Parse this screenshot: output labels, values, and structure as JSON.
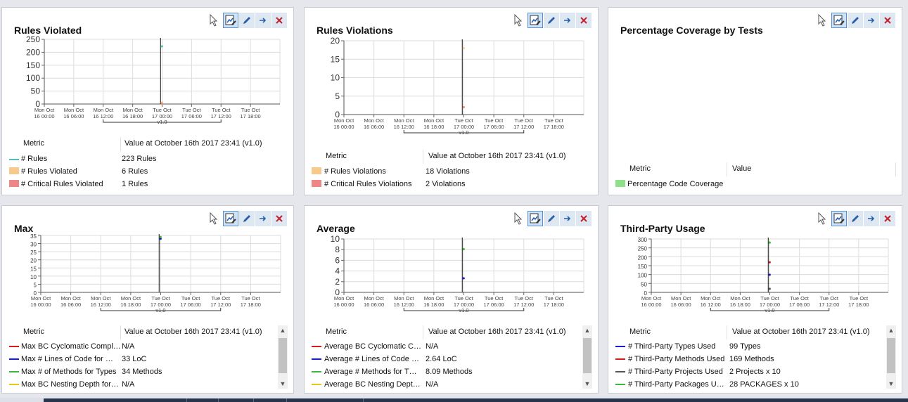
{
  "panels": [
    {
      "title": "Rules Violated",
      "legend_header": {
        "metric": "Metric",
        "value": "Value at October 16th 2017  23:41  (v1.0)"
      },
      "rows": [
        {
          "label": "# Rules",
          "value": "223 Rules",
          "color": "#4fc1b3"
        },
        {
          "label": "# Rules Violated",
          "value": "6 Rules",
          "color": "#f7c98d"
        },
        {
          "label": "# Critical Rules Violated",
          "value": "1 Rules",
          "color": "#f08585"
        }
      ],
      "chart": {
        "y_ticks": [
          "250",
          "200",
          "150",
          "100",
          "50",
          "0"
        ],
        "x_ticks": [
          [
            "Mon Oct",
            "16 00:00"
          ],
          [
            "Mon Oct",
            "16 06:00"
          ],
          [
            "Mon Oct",
            "16 12:00"
          ],
          [
            "Mon Oct",
            "16 18:00"
          ],
          [
            "Tue Oct",
            "17 00:00"
          ],
          [
            "Tue Oct",
            "17 06:00"
          ],
          [
            "Tue Oct",
            "17 12:00"
          ],
          [
            "Tue Oct",
            "17 18:00"
          ]
        ],
        "version": "v1.0"
      }
    },
    {
      "title": "Rules Violations",
      "legend_header": {
        "metric": "Metric",
        "value": "Value at October 16th 2017  23:41  (v1.0)"
      },
      "rows": [
        {
          "label": "# Rules Violations",
          "value": "18 Violations",
          "color": "#f7c98d"
        },
        {
          "label": "# Critical Rules Violations",
          "value": "2 Violations",
          "color": "#f08585"
        }
      ],
      "chart": {
        "y_ticks": [
          "20",
          "15",
          "10",
          "5",
          "0"
        ],
        "x_ticks": [
          [
            "Mon Oct",
            "16 00:00"
          ],
          [
            "Mon Oct",
            "16 06:00"
          ],
          [
            "Mon Oct",
            "16 12:00"
          ],
          [
            "Mon Oct",
            "16 18:00"
          ],
          [
            "Tue Oct",
            "17 00:00"
          ],
          [
            "Tue Oct",
            "17 06:00"
          ],
          [
            "Tue Oct",
            "17 12:00"
          ],
          [
            "Tue Oct",
            "17 18:00"
          ]
        ],
        "version": "v1.0"
      }
    },
    {
      "title": "Percentage Coverage by Tests",
      "legend_header": {
        "metric": "Metric",
        "value": "Value"
      },
      "rows": [
        {
          "label": "Percentage Code Coverage",
          "value": "",
          "color": "#8fe08a"
        }
      ]
    },
    {
      "title": "Max",
      "legend_header": {
        "metric": "Metric",
        "value": "Value at October 16th 2017  23:41  (v1.0)"
      },
      "rows": [
        {
          "label": "Max BC Cyclomatic Compl…",
          "value": "N/A",
          "color": "#d41c1c"
        },
        {
          "label": "Max # Lines of Code for …",
          "value": "33 LoC",
          "color": "#1c1cc8"
        },
        {
          "label": "Max # of Methods for Types",
          "value": "34 Methods",
          "color": "#3cb83c"
        },
        {
          "label": "Max BC Nesting Depth for…",
          "value": "N/A",
          "color": "#e6c81c"
        }
      ],
      "chart": {
        "y_ticks": [
          "35",
          "30",
          "25",
          "20",
          "15",
          "10",
          "5",
          "0"
        ],
        "x_ticks": [
          [
            "Mon Oct",
            "16 00:00"
          ],
          [
            "Mon Oct",
            "16 06:00"
          ],
          [
            "Mon Oct",
            "16 12:00"
          ],
          [
            "Mon Oct",
            "16 18:00"
          ],
          [
            "Tue Oct",
            "17 00:00"
          ],
          [
            "Tue Oct",
            "17 06:00"
          ],
          [
            "Tue Oct",
            "17 12:00"
          ],
          [
            "Tue Oct",
            "17 18:00"
          ]
        ],
        "version": "v1.0"
      }
    },
    {
      "title": "Average",
      "legend_header": {
        "metric": "Metric",
        "value": "Value at October 16th 2017  23:41  (v1.0)"
      },
      "rows": [
        {
          "label": "Average BC Cyclomatic C…",
          "value": "N/A",
          "color": "#d41c1c"
        },
        {
          "label": "Average # Lines of Code …",
          "value": "2.64 LoC",
          "color": "#1c1cc8"
        },
        {
          "label": "Average # Methods for T…",
          "value": "8.09 Methods",
          "color": "#3cb83c"
        },
        {
          "label": "Average BC Nesting Dept…",
          "value": "N/A",
          "color": "#e6c81c"
        }
      ],
      "chart": {
        "y_ticks": [
          "10",
          "8",
          "6",
          "4",
          "2",
          "0"
        ],
        "x_ticks": [
          [
            "Mon Oct",
            "16 00:00"
          ],
          [
            "Mon Oct",
            "16 06:00"
          ],
          [
            "Mon Oct",
            "16 12:00"
          ],
          [
            "Mon Oct",
            "16 18:00"
          ],
          [
            "Tue Oct",
            "17 00:00"
          ],
          [
            "Tue Oct",
            "17 06:00"
          ],
          [
            "Tue Oct",
            "17 12:00"
          ],
          [
            "Tue Oct",
            "17 18:00"
          ]
        ],
        "version": "v1.0"
      }
    },
    {
      "title": "Third-Party Usage",
      "legend_header": {
        "metric": "Metric",
        "value": "Value at October 16th 2017  23:41  (v1.0)"
      },
      "rows": [
        {
          "label": "# Third-Party Types Used",
          "value": "99 Types",
          "color": "#1c1cc8"
        },
        {
          "label": "# Third-Party Methods Used",
          "value": "169 Methods",
          "color": "#d41c1c"
        },
        {
          "label": "# Third-Party Projects Used",
          "value": "2 Projects   x 10",
          "color": "#555555"
        },
        {
          "label": "# Third-Party Packages U…",
          "value": "28 PACKAGES   x 10",
          "color": "#3cb83c"
        }
      ],
      "chart": {
        "y_ticks": [
          "300",
          "250",
          "200",
          "150",
          "100",
          "50",
          "0"
        ],
        "x_ticks": [
          [
            "Mon Oct",
            "16 00:00"
          ],
          [
            "Mon Oct",
            "16 06:00"
          ],
          [
            "Mon Oct",
            "16 12:00"
          ],
          [
            "Mon Oct",
            "16 18:00"
          ],
          [
            "Tue Oct",
            "17 00:00"
          ],
          [
            "Tue Oct",
            "17 06:00"
          ],
          [
            "Tue Oct",
            "17 12:00"
          ],
          [
            "Tue Oct",
            "17 18:00"
          ]
        ],
        "version": "v1.0"
      }
    }
  ],
  "chart_data": [
    {
      "type": "line",
      "title": "Rules Violated",
      "x_labels": [
        "Mon Oct 16 00:00",
        "Mon Oct 16 06:00",
        "Mon Oct 16 12:00",
        "Mon Oct 16 18:00",
        "Tue Oct 17 00:00",
        "Tue Oct 17 06:00",
        "Tue Oct 17 12:00",
        "Tue Oct 17 18:00"
      ],
      "ylim": [
        0,
        250
      ],
      "marker": {
        "x": "Tue Oct 17 00:00",
        "label": "v1.0"
      },
      "series": [
        {
          "name": "# Rules",
          "color": "#4fc1b3",
          "points": [
            {
              "x": "2017-10-16 23:41",
              "y": 223
            }
          ]
        },
        {
          "name": "# Rules Violated",
          "color": "#f7c98d",
          "points": [
            {
              "x": "2017-10-16 23:41",
              "y": 6
            }
          ]
        },
        {
          "name": "# Critical Rules Violated",
          "color": "#f08585",
          "points": [
            {
              "x": "2017-10-16 23:41",
              "y": 1
            }
          ]
        }
      ]
    },
    {
      "type": "line",
      "title": "Rules Violations",
      "x_labels": [
        "Mon Oct 16 00:00",
        "Mon Oct 16 06:00",
        "Mon Oct 16 12:00",
        "Mon Oct 16 18:00",
        "Tue Oct 17 00:00",
        "Tue Oct 17 06:00",
        "Tue Oct 17 12:00",
        "Tue Oct 17 18:00"
      ],
      "ylim": [
        0,
        20
      ],
      "marker": {
        "x": "Tue Oct 17 00:00",
        "label": "v1.0"
      },
      "series": [
        {
          "name": "# Rules Violations",
          "color": "#f7c98d",
          "points": [
            {
              "x": "2017-10-16 23:41",
              "y": 18
            }
          ]
        },
        {
          "name": "# Critical Rules Violations",
          "color": "#f08585",
          "points": [
            {
              "x": "2017-10-16 23:41",
              "y": 2
            }
          ]
        }
      ]
    },
    {
      "type": "line",
      "title": "Max",
      "x_labels": [
        "Mon Oct 16 00:00",
        "Mon Oct 16 06:00",
        "Mon Oct 16 12:00",
        "Mon Oct 16 18:00",
        "Tue Oct 17 00:00",
        "Tue Oct 17 06:00",
        "Tue Oct 17 12:00",
        "Tue Oct 17 18:00"
      ],
      "ylim": [
        0,
        35
      ],
      "marker": {
        "x": "Tue Oct 17 00:00",
        "label": "v1.0"
      },
      "series": [
        {
          "name": "Max # Lines of Code for …",
          "color": "#1c1cc8",
          "points": [
            {
              "x": "2017-10-16 23:41",
              "y": 33
            }
          ]
        },
        {
          "name": "Max # of Methods for Types",
          "color": "#3cb83c",
          "points": [
            {
              "x": "2017-10-16 23:41",
              "y": 34
            }
          ]
        }
      ]
    },
    {
      "type": "line",
      "title": "Average",
      "x_labels": [
        "Mon Oct 16 00:00",
        "Mon Oct 16 06:00",
        "Mon Oct 16 12:00",
        "Mon Oct 16 18:00",
        "Tue Oct 17 00:00",
        "Tue Oct 17 06:00",
        "Tue Oct 17 12:00",
        "Tue Oct 17 18:00"
      ],
      "ylim": [
        0,
        10
      ],
      "marker": {
        "x": "Tue Oct 17 00:00",
        "label": "v1.0"
      },
      "series": [
        {
          "name": "Average # Lines of Code …",
          "color": "#1c1cc8",
          "points": [
            {
              "x": "2017-10-16 23:41",
              "y": 2.64
            }
          ]
        },
        {
          "name": "Average # Methods for T…",
          "color": "#3cb83c",
          "points": [
            {
              "x": "2017-10-16 23:41",
              "y": 8.09
            }
          ]
        }
      ]
    },
    {
      "type": "line",
      "title": "Third-Party Usage",
      "x_labels": [
        "Mon Oct 16 00:00",
        "Mon Oct 16 06:00",
        "Mon Oct 16 12:00",
        "Mon Oct 16 18:00",
        "Tue Oct 17 00:00",
        "Tue Oct 17 06:00",
        "Tue Oct 17 12:00",
        "Tue Oct 17 18:00"
      ],
      "ylim": [
        0,
        300
      ],
      "marker": {
        "x": "Tue Oct 17 00:00",
        "label": "v1.0"
      },
      "series": [
        {
          "name": "# Third-Party Types Used",
          "color": "#1c1cc8",
          "points": [
            {
              "x": "2017-10-16 23:41",
              "y": 99
            }
          ]
        },
        {
          "name": "# Third-Party Methods Used",
          "color": "#d41c1c",
          "points": [
            {
              "x": "2017-10-16 23:41",
              "y": 169
            }
          ]
        },
        {
          "name": "# Third-Party Projects Used",
          "color": "#555555",
          "points": [
            {
              "x": "2017-10-16 23:41",
              "y": 20
            }
          ]
        },
        {
          "name": "# Third-Party Packages U…",
          "color": "#3cb83c",
          "points": [
            {
              "x": "2017-10-16 23:41",
              "y": 280
            }
          ]
        }
      ]
    }
  ]
}
